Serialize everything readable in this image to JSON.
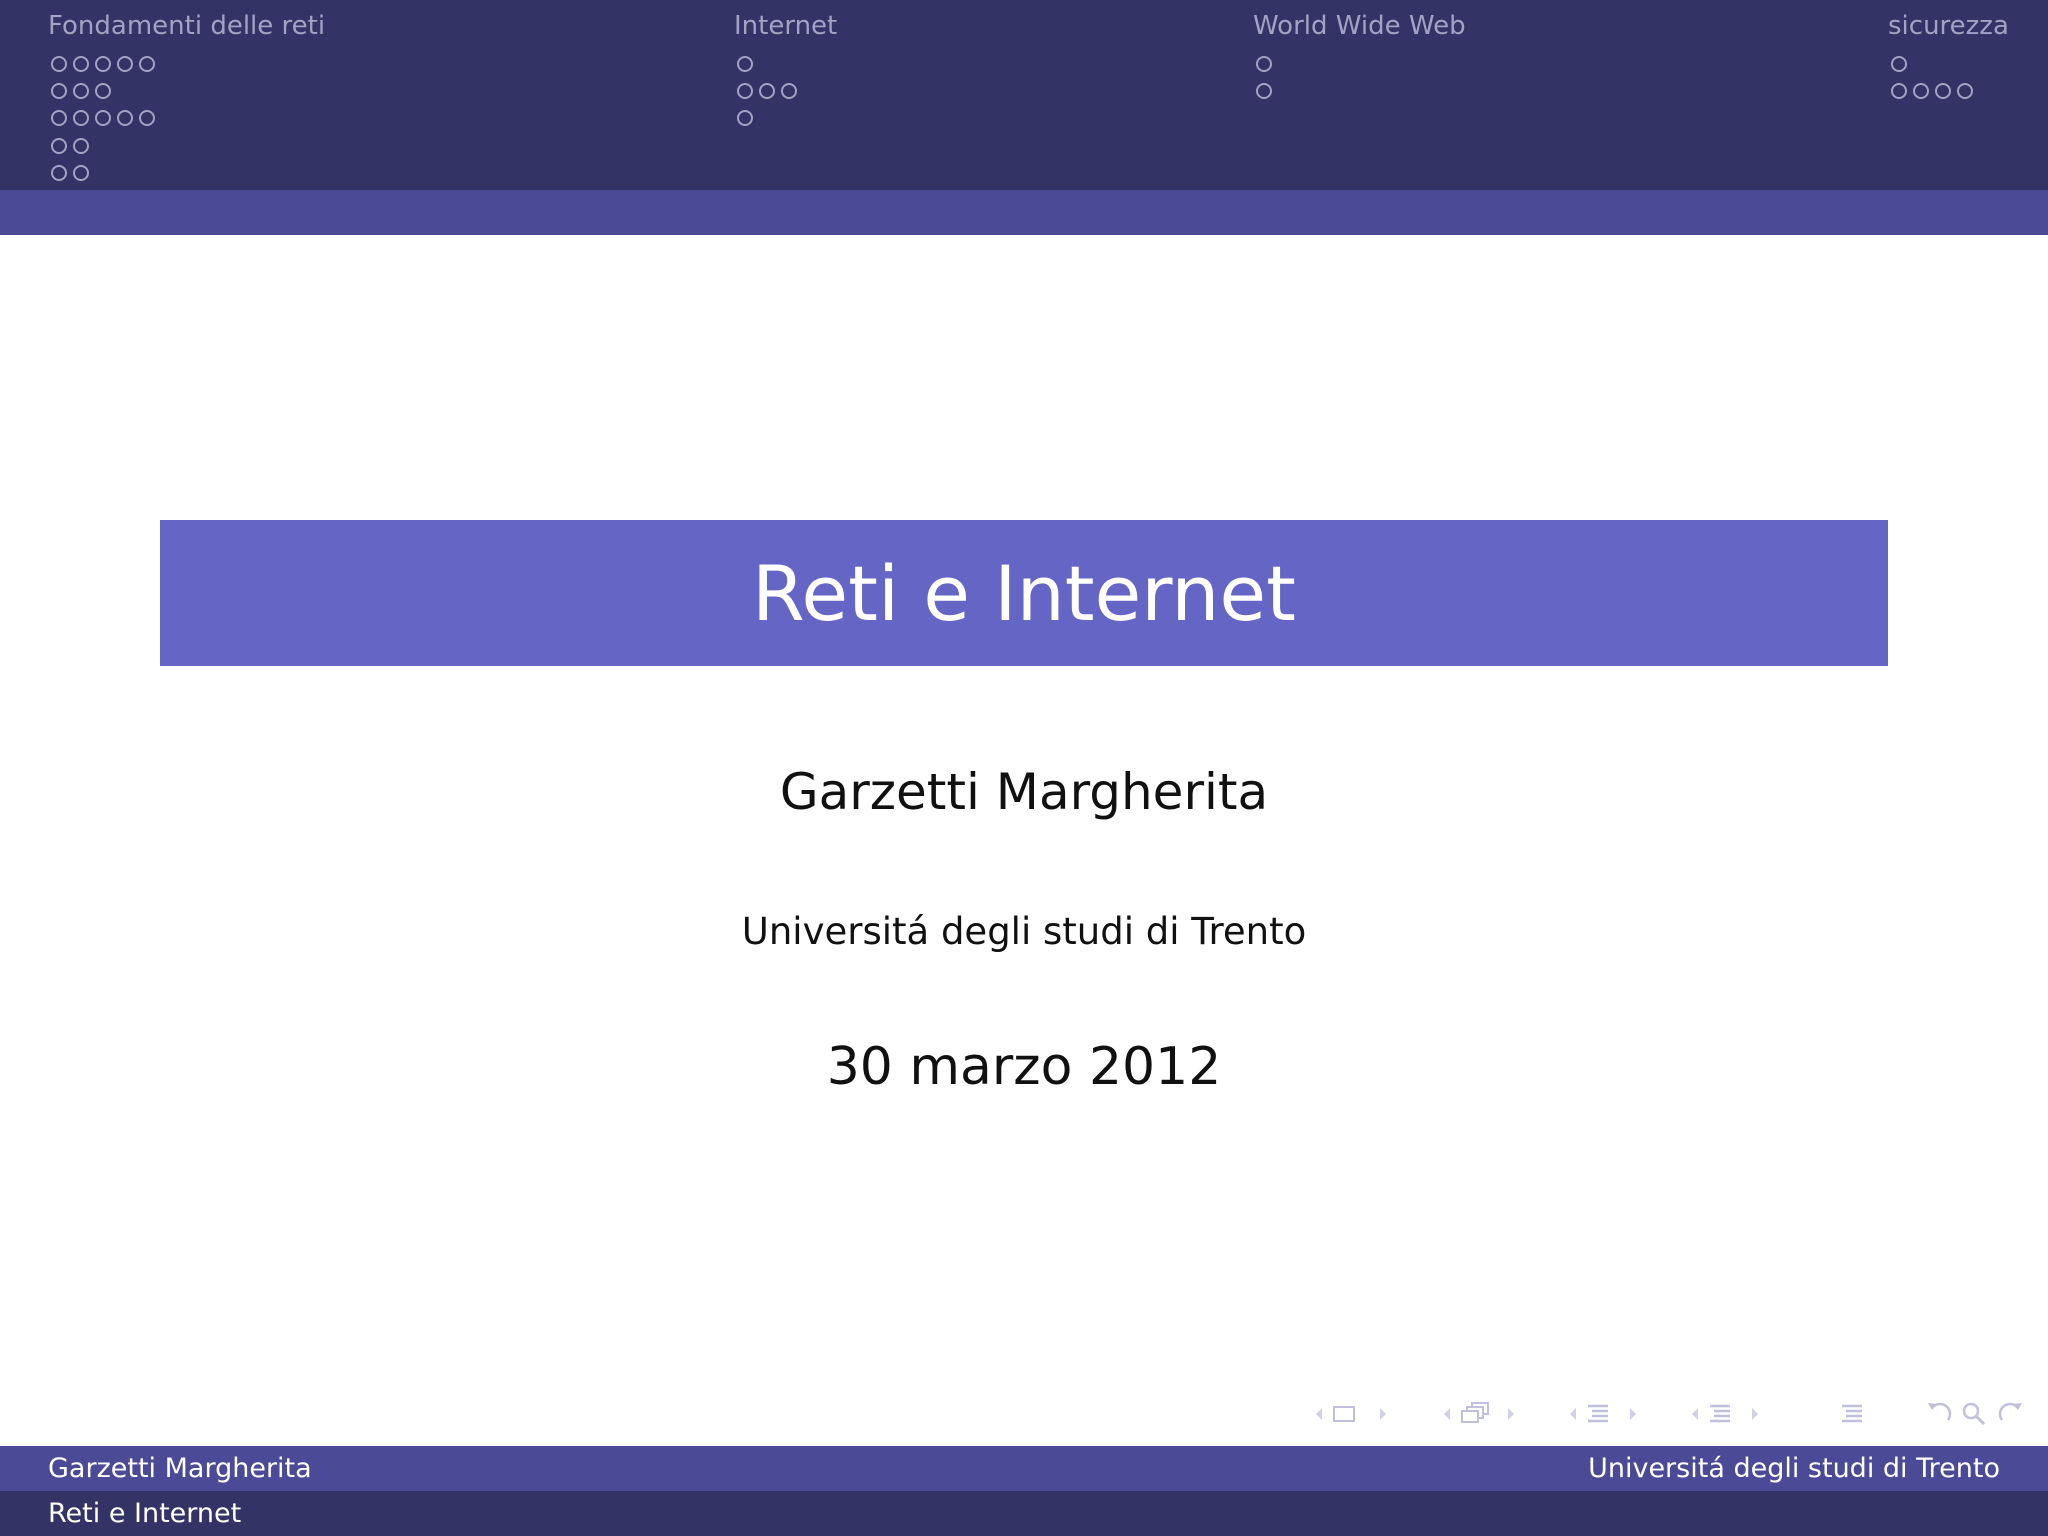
{
  "navigation": {
    "sections": [
      {
        "title": "Fondamenti delle reti",
        "subsection_frames": [
          5,
          3,
          5,
          2,
          2
        ]
      },
      {
        "title": "Internet",
        "subsection_frames": [
          1,
          3,
          1
        ]
      },
      {
        "title": "World Wide Web",
        "subsection_frames": [
          1,
          1
        ]
      },
      {
        "title": "sicurezza",
        "subsection_frames": [
          1,
          4
        ]
      }
    ]
  },
  "slide": {
    "title": "Reti e Internet",
    "author": "Garzetti Margherita",
    "institute": "Universitá degli studi di Trento",
    "date": "30 marzo 2012"
  },
  "footer": {
    "author": "Garzetti Margherita",
    "institute": "Universitá degli studi di Trento",
    "title": "Reti e Internet"
  },
  "nav_symbols": [
    "slide-nav-icon",
    "frame-nav-icon",
    "subsection-nav-icon",
    "section-nav-icon",
    "document-nav-icon",
    "back-icon",
    "search-icon",
    "forward-icon"
  ],
  "colors": {
    "header_dark": "#333366",
    "header_band": "#4a4a96",
    "title_box": "#6565c6",
    "nav_text": "#a2a2c4"
  }
}
